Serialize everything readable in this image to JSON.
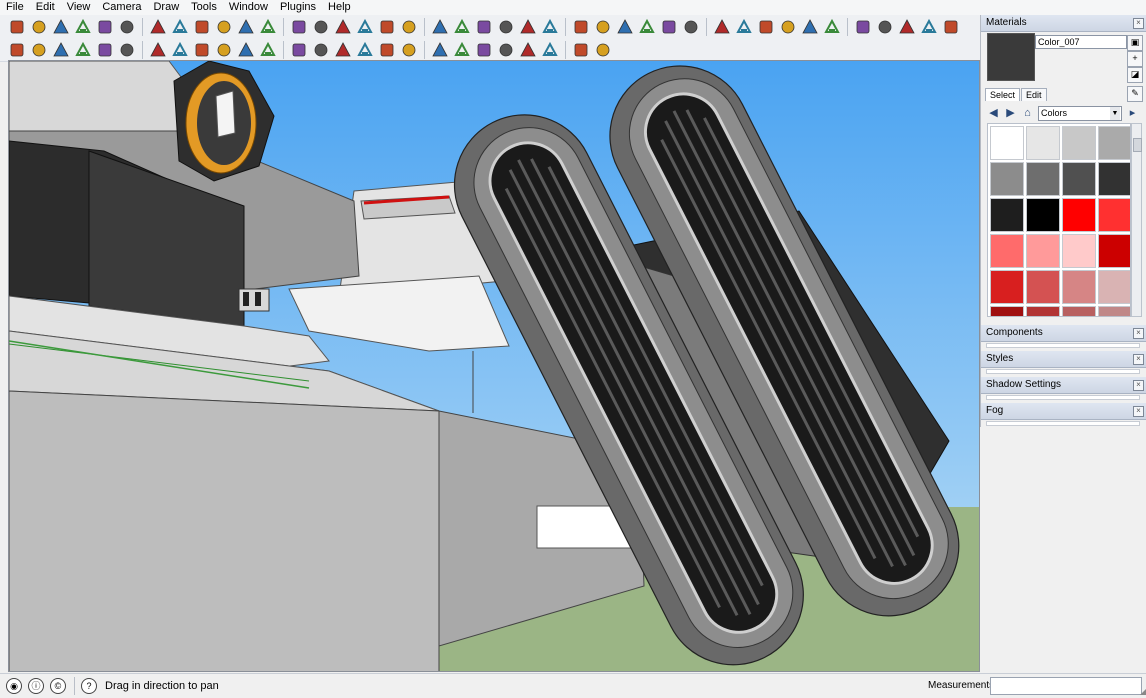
{
  "menu": [
    "File",
    "Edit",
    "View",
    "Camera",
    "Draw",
    "Tools",
    "Window",
    "Plugins",
    "Help"
  ],
  "toolbar": {
    "row1_icons": [
      "select-icon",
      "pencil-icon",
      "rectangle-icon",
      "circle-icon",
      "arc-icon",
      "make-component-icon",
      "eraser-icon",
      "tape-measure-icon",
      "paint-bucket-icon",
      "push-pull-icon",
      "move-icon",
      "rotate-icon",
      "offset-icon",
      "orbit-icon",
      "pan-icon",
      "zoom-icon",
      "zoom-extents-icon",
      "add-location-icon",
      "toggle-terrain-icon",
      "get-models-icon",
      "share-model-icon",
      "share-component-icon",
      "get-photo-texture-icon",
      "style-xray-icon",
      "style-backedges-icon",
      "style-wireframe-icon",
      "style-hidden-line-icon",
      "style-shaded-icon",
      "style-textured-icon",
      "walk-icon",
      "look-around-icon",
      "position-camera-icon",
      "green-plugin-icon",
      "star-plugin-icon",
      "wrench-plugin-icon",
      "chart-plugin-icon",
      "sphere-plugin-icon",
      "lens-plugin-icon",
      "hand-tool-icon",
      "cut-icon",
      "cleanup-icon"
    ],
    "row2_icons": [
      "axes-icon",
      "section-icon",
      "tag-icon",
      "protractor-icon",
      "dimension-icon",
      "text-icon",
      "sandbox-icon",
      "geo-icon",
      "level-icon",
      "box-icon",
      "iso-view-icon",
      "top-view-icon",
      "front-view-icon",
      "right-view-icon",
      "back-view-icon",
      "left-view-icon",
      "union-icon",
      "subtract-icon",
      "intersect-icon",
      "trim-icon",
      "split-icon",
      "outer-shell-icon",
      "solid-icon",
      "sweep-icon",
      "fillet-icon",
      "settings-icon"
    ]
  },
  "tray": {
    "materials": {
      "title": "Materials",
      "material_name": "Color_007",
      "tabs": [
        "Select",
        "Edit"
      ],
      "library": "Colors",
      "swatch_colors": [
        "#ffffff",
        "#e6e6e6",
        "#c8c8c8",
        "#aaaaaa",
        "#8c8c8c",
        "#6e6e6e",
        "#505050",
        "#323232",
        "#1e1e1e",
        "#000000",
        "#ff0000",
        "#ff3030",
        "#ff6b6b",
        "#ff9a9a",
        "#ffcaca",
        "#cc0000",
        "#d81f1f",
        "#d45252",
        "#d68585",
        "#d9b3b3",
        "#a01010",
        "#b23434",
        "#b86060",
        "#c08888"
      ]
    },
    "components": {
      "title": "Components"
    },
    "styles": {
      "title": "Styles"
    },
    "shadow": {
      "title": "Shadow Settings"
    },
    "fog": {
      "title": "Fog"
    }
  },
  "status": {
    "hint": "Drag in direction to pan",
    "measurements_label": "Measurements"
  }
}
